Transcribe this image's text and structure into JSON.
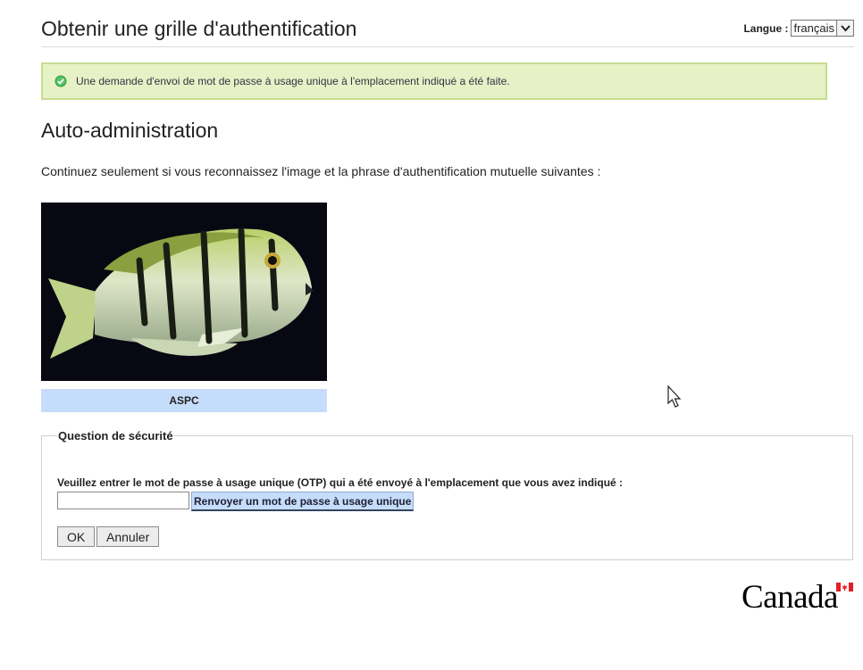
{
  "header": {
    "title": "Obtenir une grille d'authentification",
    "language_label": "Langue :",
    "language_value": "français"
  },
  "notice": {
    "text": "Une demande d'envoi de mot de passe à usage unique à l'emplacement indiqué a été faite.",
    "icon": "check-circle-icon",
    "bg_color": "#e7f1c6",
    "border_color": "#c7dd8f"
  },
  "main": {
    "section_title": "Auto-administration",
    "intro": "Continuez seulement si vous reconnaissez l'image et la phrase d'authentification mutuelle suivantes :",
    "image_caption": "ASPC",
    "caption_bg": "#c5dcfb"
  },
  "security": {
    "legend": "Question de sécurité",
    "otp_label": "Veuillez entrer le mot de passe à usage unique (OTP) qui a été envoyé à l'emplacement que vous avez indiqué :",
    "otp_value": "",
    "resend_label": "Renvoyer un mot de passe à usage unique",
    "ok_label": "OK",
    "cancel_label": "Annuler"
  },
  "footer": {
    "wordmark": "Canada"
  }
}
